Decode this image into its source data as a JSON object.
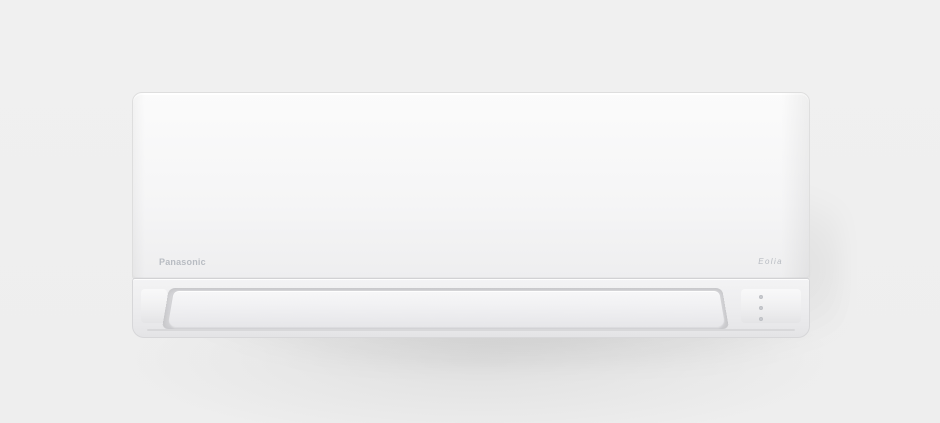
{
  "brand": {
    "name": "Panasonic",
    "model": "Eolia"
  },
  "colors": {
    "background": "#efefef",
    "unit_body": "#f7f7f8",
    "logo_text": "#b8bcc2"
  },
  "icons": {
    "indicator_lights": [
      "indicator-light-icon",
      "indicator-light-icon",
      "indicator-light-icon"
    ]
  }
}
